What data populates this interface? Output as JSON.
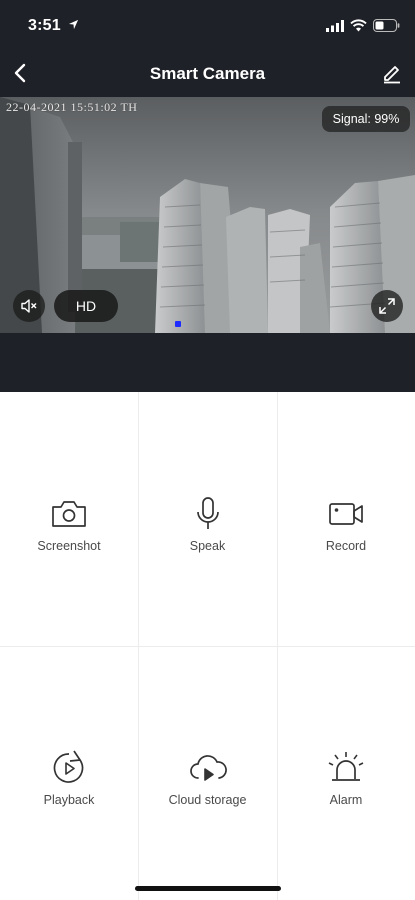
{
  "status_bar": {
    "time": "3:51"
  },
  "nav": {
    "title": "Smart Camera"
  },
  "video": {
    "timestamp": "22-04-2021 15:51:02 TH",
    "signal": "Signal: 99%",
    "quality": "HD"
  },
  "actions": [
    {
      "label": "Screenshot",
      "icon": "camera-icon"
    },
    {
      "label": "Speak",
      "icon": "microphone-icon"
    },
    {
      "label": "Record",
      "icon": "video-camera-icon"
    },
    {
      "label": "Playback",
      "icon": "playback-icon"
    },
    {
      "label": "Cloud storage",
      "icon": "cloud-play-icon"
    },
    {
      "label": "Alarm",
      "icon": "alarm-siren-icon"
    }
  ],
  "colors": {
    "header_bg": "#1f2128",
    "icon_stroke": "#333333",
    "label_text": "#4a4a4a"
  }
}
